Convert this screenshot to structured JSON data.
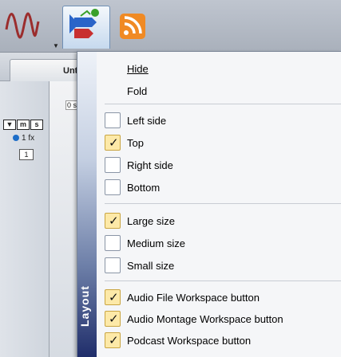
{
  "document": {
    "tab_label": "Unt",
    "timeline_marker": "0 s"
  },
  "track": {
    "mute_solo_buttons": [
      "▼",
      "m",
      "s"
    ],
    "effects_label": "1 fx",
    "track_number": "1"
  },
  "toolbar": {
    "buttons": [
      {
        "icon": "waveform-icon"
      },
      {
        "icon": "layout-icon"
      },
      {
        "icon": "rss-icon"
      }
    ]
  },
  "menu": {
    "gutter_label": "Layout",
    "groups": [
      [
        {
          "label": "Hide",
          "checkable": false
        },
        {
          "label": "Fold",
          "checkable": false
        }
      ],
      [
        {
          "label": "Left side",
          "checked": false
        },
        {
          "label": "Top",
          "checked": true
        },
        {
          "label": "Right side",
          "checked": false
        },
        {
          "label": "Bottom",
          "checked": false
        }
      ],
      [
        {
          "label": "Large size",
          "checked": true
        },
        {
          "label": "Medium size",
          "checked": false
        },
        {
          "label": "Small size",
          "checked": false
        }
      ],
      [
        {
          "label": "Audio File Workspace button",
          "checked": true
        },
        {
          "label": "Audio Montage Workspace button",
          "checked": true
        },
        {
          "label": "Podcast Workspace button",
          "checked": true
        }
      ]
    ]
  },
  "colors": {
    "check_on": "#fde9a8",
    "gutter_dark": "#1f2d6a",
    "rss": "#f08a24"
  }
}
